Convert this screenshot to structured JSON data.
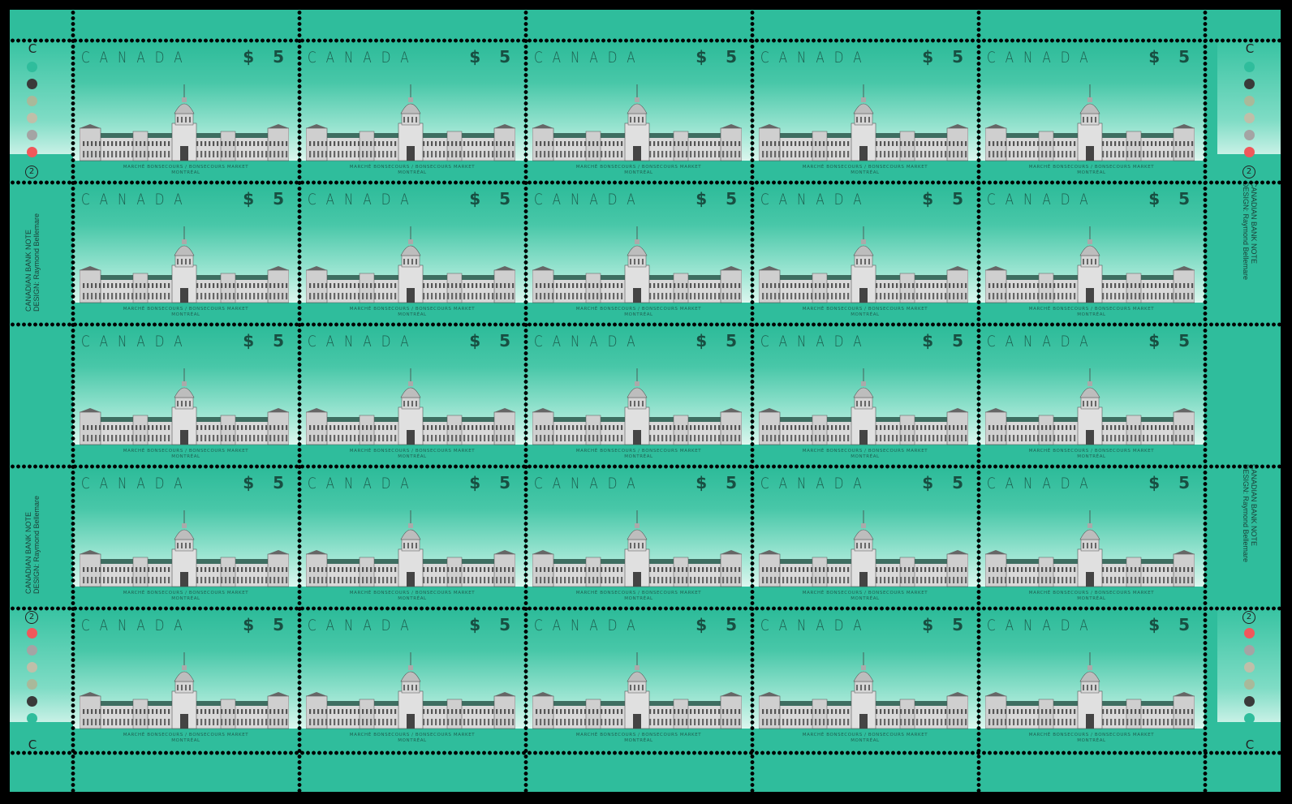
{
  "sheet": {
    "rows": 5,
    "cols": 5,
    "colors": {
      "margin": "#2fbd9c",
      "sky_top": "#2cbb99",
      "sky_bottom": "#dcf6ee",
      "text": "#1c5b4c",
      "building_roof": "#3e6e61",
      "building_facade": "#d9d9d9"
    }
  },
  "stamp": {
    "country": "CANADA",
    "denomination": "$ 5",
    "caption_line1": "MARCHÉ BONSECOURS / BONSECOURS MARKET",
    "caption_line2": "MONTRÉAL"
  },
  "inscriptions": {
    "plate_letter": "C",
    "plate_number": "2",
    "printer": "CANADIAN BANK NOTE",
    "designer": "DESIGN: Raymond Bellemare"
  },
  "color_dots": {
    "top": [
      "#2fbd9c",
      "#3a3a3a",
      "#a9b99a",
      "#bfbfa9",
      "#a4a4a4",
      "#f0585b"
    ],
    "bottom": [
      "#f0585b",
      "#a4a4a4",
      "#bfbfa9",
      "#a9b99a",
      "#3a3a3a",
      "#2fbd9c"
    ]
  }
}
